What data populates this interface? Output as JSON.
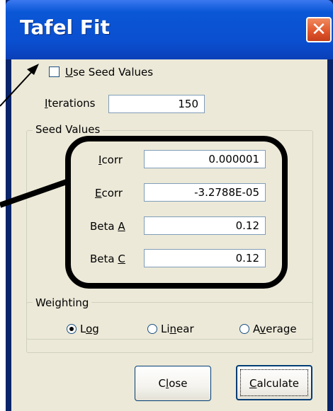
{
  "window": {
    "title": "Tafel Fit"
  },
  "options": {
    "use_seed_label_pre": "",
    "use_seed_label_accel": "U",
    "use_seed_label_post": "se Seed Values",
    "use_seed_checked": false,
    "iterations_label_accel": "I",
    "iterations_label_post": "terations",
    "iterations_value": "150"
  },
  "seed_values": {
    "legend": "Seed Values",
    "icorr_label_accel": "I",
    "icorr_label_post": "corr",
    "icorr_value": "0.000001",
    "ecorr_label_accel": "E",
    "ecorr_label_post": "corr",
    "ecorr_value": "-3.2788E-05",
    "beta_a_label_pre": "Beta ",
    "beta_a_label_accel": "A",
    "beta_a_value": "0.12",
    "beta_c_label_pre": "Beta ",
    "beta_c_label_accel": "C",
    "beta_c_value": "0.12"
  },
  "weighting": {
    "legend": "Weighting",
    "log_pre": "L",
    "log_accel": "o",
    "log_post": "g",
    "linear_pre": "Li",
    "linear_accel": "n",
    "linear_post": "ear",
    "average_pre": "A",
    "average_accel": "v",
    "average_post": "erage",
    "selected": "Log"
  },
  "buttons": {
    "close_pre": "C",
    "close_accel": "l",
    "close_post": "ose",
    "calculate_pre": "",
    "calculate_accel": "C",
    "calculate_post": "alculate"
  },
  "colors": {
    "titlebar": "#0a4fd0",
    "close_button": "#e0542a",
    "dialog_bg": "#ece9d8",
    "annotation": "#000000"
  }
}
